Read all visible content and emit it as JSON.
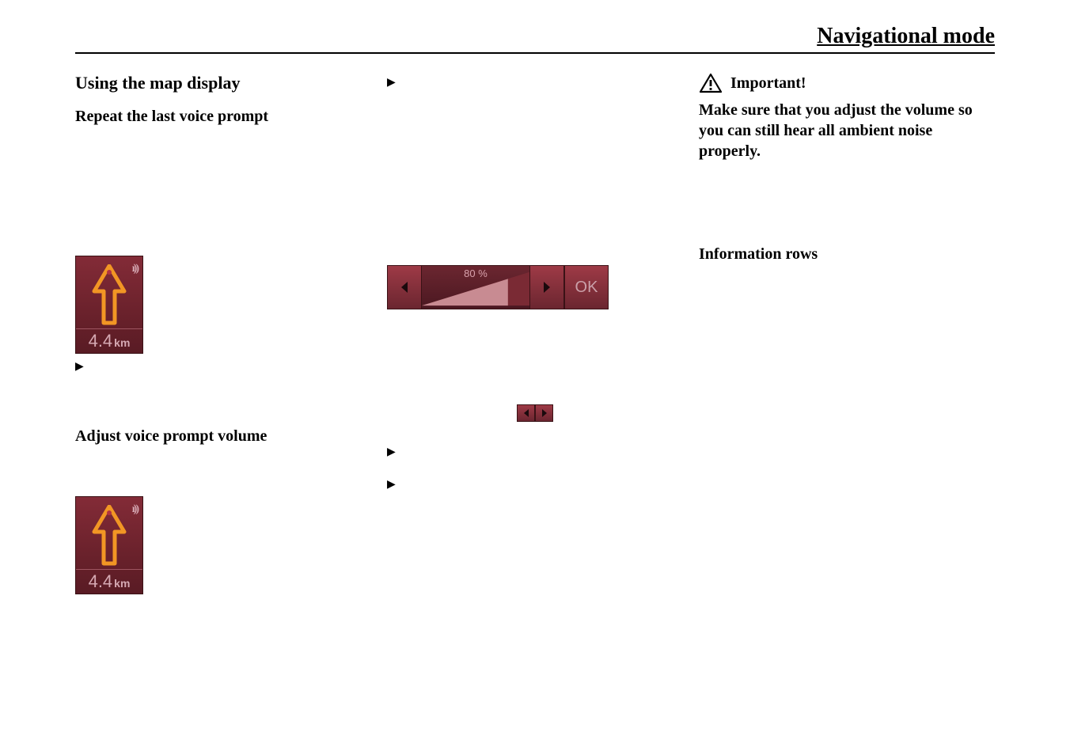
{
  "page_title": "Navigational mode",
  "left": {
    "heading": "Using the map display",
    "sub_heading": "Repeat the last voice prompt",
    "adjust_heading": "Adjust voice prompt volume",
    "tile1": {
      "distance_value": "4.4",
      "distance_unit": "km"
    },
    "tile2": {
      "distance_value": "4.4",
      "distance_unit": "km"
    }
  },
  "mid": {
    "volume_percent_label": "80 %",
    "volume_percent_value": 80,
    "ok_label": "OK"
  },
  "right": {
    "important_label": "Important!",
    "important_body": "Make sure that you adjust the volume so you can still hear all ambient noise properly.",
    "info_heading": "Information rows"
  }
}
